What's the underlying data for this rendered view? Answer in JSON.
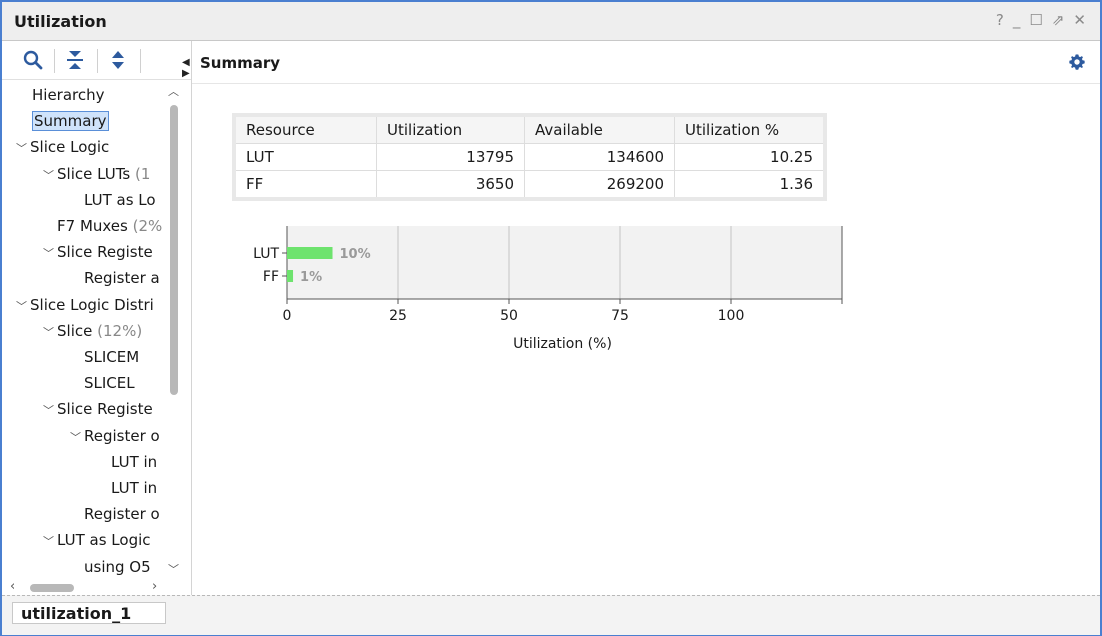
{
  "window": {
    "title": "Utilization",
    "controls": [
      "?",
      "_",
      "☐",
      "⇗",
      "✕"
    ]
  },
  "left_panel": {
    "toolbar_icons": [
      "search-icon",
      "collapse-all-icon",
      "expand-all-icon"
    ],
    "tree": [
      {
        "label": "Hierarchy",
        "pct": "",
        "indent": 0,
        "chevron": false,
        "selected": false
      },
      {
        "label": "Summary",
        "pct": "",
        "indent": 0,
        "chevron": false,
        "selected": true
      },
      {
        "label": "Slice Logic",
        "pct": "",
        "indent": 0,
        "chevron": true,
        "selected": false
      },
      {
        "label": "Slice LUTs",
        "pct": "(1",
        "indent": 1,
        "chevron": true,
        "selected": false
      },
      {
        "label": "LUT as Lo",
        "pct": "",
        "indent": 2,
        "chevron": false,
        "selected": false
      },
      {
        "label": "F7 Muxes",
        "pct": "(2%",
        "indent": 1,
        "chevron": false,
        "selected": false
      },
      {
        "label": "Slice Registe",
        "pct": "",
        "indent": 1,
        "chevron": true,
        "selected": false
      },
      {
        "label": "Register a",
        "pct": "",
        "indent": 2,
        "chevron": false,
        "selected": false
      },
      {
        "label": "Slice Logic Distri",
        "pct": "",
        "indent": 0,
        "chevron": true,
        "selected": false
      },
      {
        "label": "Slice",
        "pct": "(12%)",
        "indent": 1,
        "chevron": true,
        "selected": false
      },
      {
        "label": "SLICEM",
        "pct": "",
        "indent": 2,
        "chevron": false,
        "selected": false
      },
      {
        "label": "SLICEL",
        "pct": "",
        "indent": 2,
        "chevron": false,
        "selected": false
      },
      {
        "label": "Slice Registe",
        "pct": "",
        "indent": 1,
        "chevron": true,
        "selected": false
      },
      {
        "label": "Register o",
        "pct": "",
        "indent": 2,
        "chevron": true,
        "selected": false
      },
      {
        "label": "LUT in",
        "pct": "",
        "indent": 3,
        "chevron": false,
        "selected": false
      },
      {
        "label": "LUT in",
        "pct": "",
        "indent": 3,
        "chevron": false,
        "selected": false
      },
      {
        "label": "Register o",
        "pct": "",
        "indent": 2,
        "chevron": false,
        "selected": false
      },
      {
        "label": "LUT as Logic",
        "pct": "",
        "indent": 1,
        "chevron": true,
        "selected": false
      },
      {
        "label": "using O5",
        "pct": "",
        "indent": 2,
        "chevron": false,
        "selected": false
      }
    ]
  },
  "main": {
    "header_title": "Summary",
    "table": {
      "columns": [
        "Resource",
        "Utilization",
        "Available",
        "Utilization %"
      ],
      "rows": [
        [
          "LUT",
          "13795",
          "134600",
          "10.25"
        ],
        [
          "FF",
          "3650",
          "269200",
          "1.36"
        ]
      ]
    }
  },
  "chart_data": {
    "type": "bar",
    "orientation": "horizontal",
    "categories": [
      "LUT",
      "FF"
    ],
    "values": [
      10.25,
      1.36
    ],
    "data_labels": [
      "10%",
      "1%"
    ],
    "xlabel": "Utilization (%)",
    "xticks": [
      0,
      25,
      50,
      75,
      100
    ],
    "xlim": [
      0,
      125
    ],
    "grid": true,
    "bar_color": "#6ee36e",
    "plot_bg": "#f2f2f2"
  },
  "footer": {
    "tab_label": "utilization_1"
  },
  "colors": {
    "accent": "#4a7fd0",
    "selection": "#cfe3fb",
    "icon": "#2d5a9e"
  }
}
